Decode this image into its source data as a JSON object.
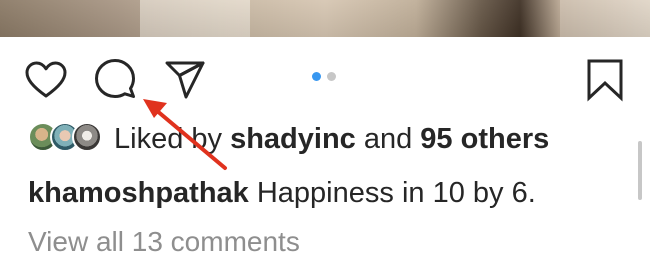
{
  "post": {
    "liked_by_prefix": "Liked by ",
    "liked_by_user": "shadyinc",
    "liked_by_joiner": " and ",
    "liked_by_others": "95 others",
    "caption_user": "khamoshpathak",
    "caption_text": " Happiness in 10 by 6.",
    "view_comments": "View all 13 comments",
    "carousel": {
      "count": 2,
      "active_index": 0
    }
  },
  "icons": {
    "like": "heart-icon",
    "comment": "comment-bubble-icon",
    "share": "paper-plane-icon",
    "save": "bookmark-icon"
  },
  "colors": {
    "text": "#262626",
    "muted": "#8e8e8e",
    "accent_dot": "#3897f0",
    "inactive_dot": "#c7c7c7",
    "annotation_arrow": "#e0321e"
  }
}
